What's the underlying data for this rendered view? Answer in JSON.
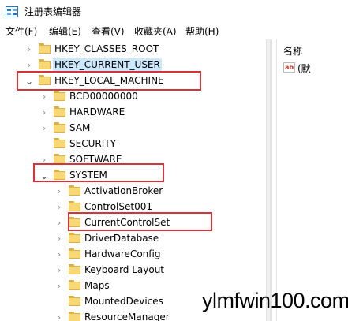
{
  "window": {
    "title": "注册表编辑器",
    "icon": "regedit-icon"
  },
  "menu": [
    "文件(F)",
    "编辑(E)",
    "查看(V)",
    "收藏夹(A)",
    "帮助(H)"
  ],
  "tree": [
    {
      "label": "HKEY_CLASSES_ROOT",
      "expander": "collapsed",
      "selected": false
    },
    {
      "label": "HKEY_CURRENT_USER",
      "expander": "collapsed",
      "selected": true
    },
    {
      "label": "HKEY_LOCAL_MACHINE",
      "expander": "expanded",
      "selected": false
    },
    {
      "label": "BCD00000000",
      "expander": "collapsed",
      "selected": false
    },
    {
      "label": "HARDWARE",
      "expander": "collapsed",
      "selected": false
    },
    {
      "label": "SAM",
      "expander": "collapsed",
      "selected": false
    },
    {
      "label": "SECURITY",
      "expander": "none",
      "selected": false
    },
    {
      "label": "SOFTWARE",
      "expander": "collapsed",
      "selected": false
    },
    {
      "label": "SYSTEM",
      "expander": "expanded",
      "selected": false
    },
    {
      "label": "ActivationBroker",
      "expander": "collapsed",
      "selected": false
    },
    {
      "label": "ControlSet001",
      "expander": "collapsed",
      "selected": false
    },
    {
      "label": "CurrentControlSet",
      "expander": "collapsed",
      "selected": false
    },
    {
      "label": "DriverDatabase",
      "expander": "collapsed",
      "selected": false
    },
    {
      "label": "HardwareConfig",
      "expander": "collapsed",
      "selected": false
    },
    {
      "label": "Keyboard Layout",
      "expander": "collapsed",
      "selected": false
    },
    {
      "label": "Maps",
      "expander": "collapsed",
      "selected": false
    },
    {
      "label": "MountedDevices",
      "expander": "none",
      "selected": false
    },
    {
      "label": "ResourceManager",
      "expander": "collapsed",
      "selected": false
    }
  ],
  "list": {
    "column_name": "名称",
    "values": [
      {
        "icon": "string-value-icon",
        "icon_text": "ab",
        "name": "(默"
      }
    ]
  },
  "highlights": [
    "HKEY_LOCAL_MACHINE",
    "SYSTEM",
    "CurrentControlSet"
  ],
  "watermark": "ylmfwin100.com",
  "colors": {
    "highlight_box": "#d7323a",
    "selection": "#cce8ff",
    "folder": "#f8d775"
  }
}
